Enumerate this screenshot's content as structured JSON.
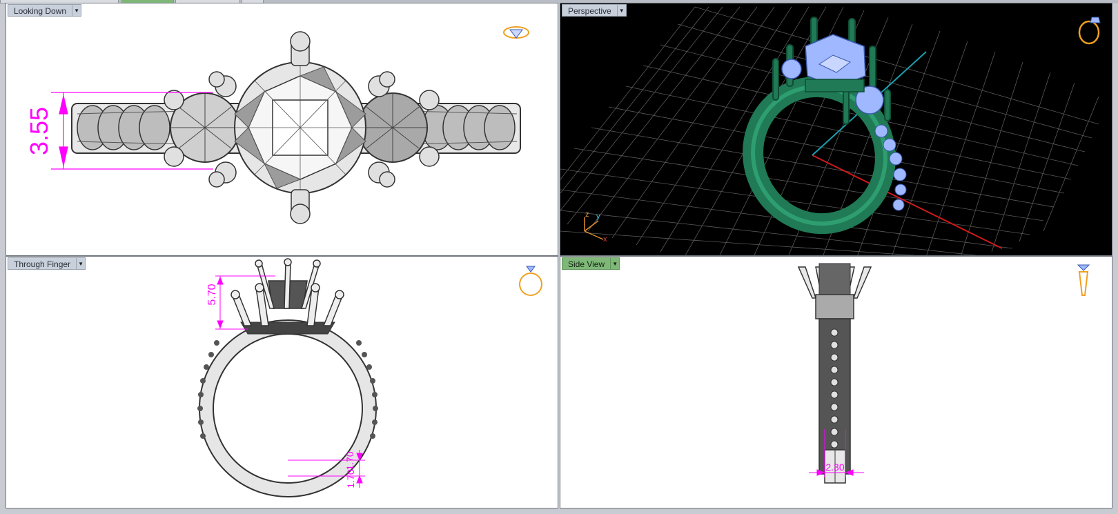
{
  "viewports": {
    "top_left": {
      "label": "Looking Down",
      "dimension": "3.55"
    },
    "top_right": {
      "label": "Perspective",
      "axes": {
        "z": "z",
        "y": "y",
        "x": "x"
      }
    },
    "bottom_left": {
      "label": "Through Finger",
      "dimension_top": "5.70",
      "dimension_bottom": "1.70"
    },
    "bottom_right": {
      "label": "Side View",
      "dimension": "2.30"
    }
  },
  "colors": {
    "dimension": "#ff00ff",
    "active_label": "#7fb779",
    "ring_green": "#1f7a55",
    "gem_blue": "#9fb8ff",
    "widget_orange": "#f0a020"
  },
  "icons": [
    "view-menu-arrow-icon",
    "ring-widget-icon"
  ]
}
